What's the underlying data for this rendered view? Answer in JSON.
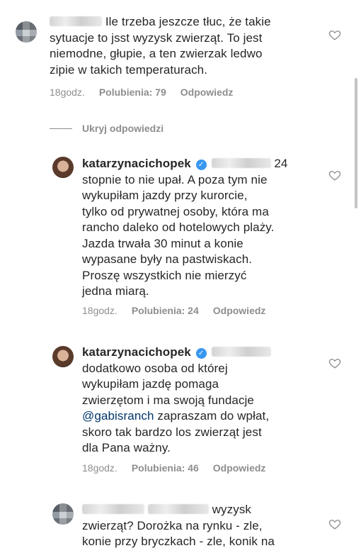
{
  "comments": [
    {
      "text_lines": [
        "Ile trzeba jeszcze tłuc, że takie",
        "sytuacje to jsst wyzysk zwierząt. To jest",
        "niemodne, głupie, a ten zwierzak ledwo",
        "zipie w takich temperaturach."
      ],
      "time": "18godz.",
      "likes": "Polubienia: 79",
      "reply": "Odpowiedz"
    },
    {
      "user": "katarzynacichopek",
      "first_tail": "24",
      "text_lines": [
        "stopnie to nie upał. A poza tym nie",
        "wykupiłam jazdy przy kurorcie,",
        "tylko od prywatnej osoby, która ma",
        "rancho daleko od hotelowych plaży.",
        "Jazda trwała 30 minut a konie",
        "wypasane były na pastwiskach.",
        "Proszę wszystkich nie mierzyć",
        "jedna miarą."
      ],
      "time": "18godz.",
      "likes": "Polubienia: 24",
      "reply": "Odpowiedz"
    },
    {
      "user": "katarzynacichopek",
      "line1": "dodatkowo osoba od której",
      "line2": "wykupiłam jazdę pomaga",
      "line3": "zwierzętom i ma swoją fundacje",
      "mention": "@gabisranch",
      "line4_tail": " zapraszam do wpłat,",
      "line5": "skoro tak bardzo los zwierząt jest",
      "line6": "dla Pana ważny.",
      "time": "18godz.",
      "likes": "Polubienia: 46",
      "reply": "Odpowiedz"
    },
    {
      "first_tail": "wyzysk",
      "text_lines": [
        "zwierząt? Dorożka na rynku - zle,",
        "konie przy bryczkach - zle, konik na"
      ]
    }
  ],
  "hide_replies": "Ukryj odpowiedzi"
}
